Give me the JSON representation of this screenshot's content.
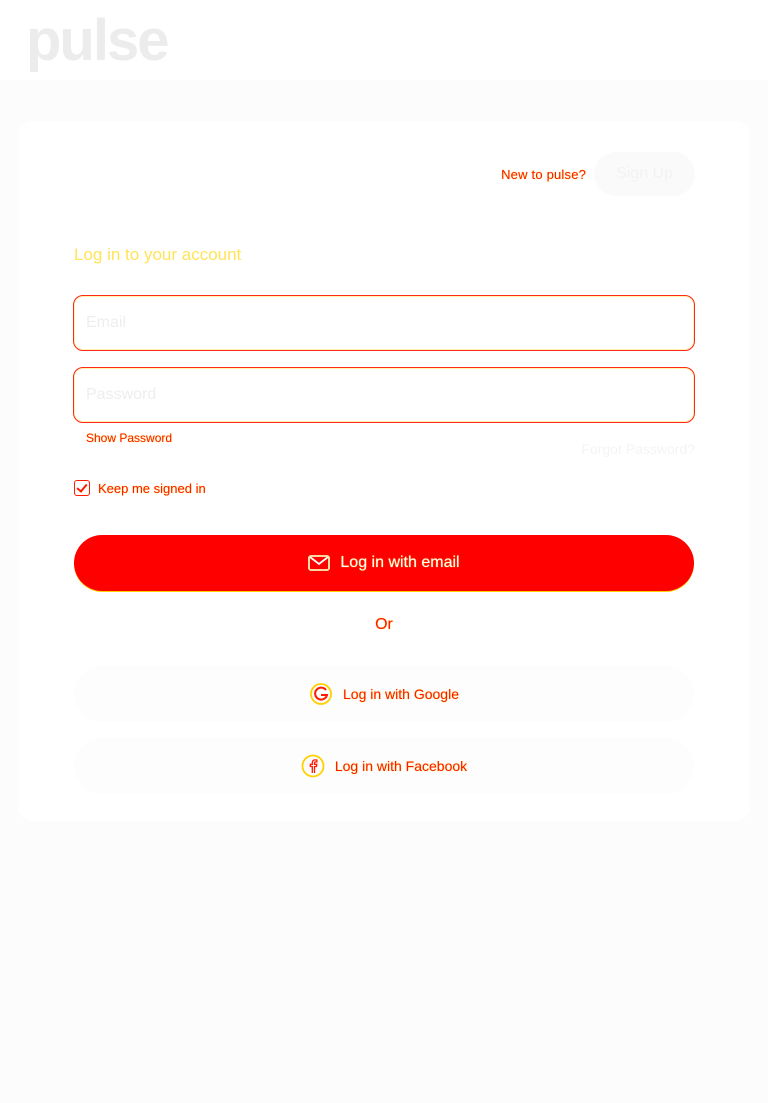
{
  "header": {
    "logo_text": "pulse"
  },
  "signup": {
    "prompt": "New to pulse?",
    "button_label": "Sign Up"
  },
  "login": {
    "heading": "Log in to your account",
    "email_placeholder": "Email",
    "password_placeholder": "Password",
    "show_password_label": "Show Password",
    "forgot_password_label": "Forgot Password?",
    "keep_signed_in_label": "Keep me signed in",
    "keep_signed_in_checked": true,
    "email_button_label": "Log in with email",
    "or_label": "Or",
    "google_button_label": "Log in with Google",
    "facebook_button_label": "Log in with Facebook"
  },
  "icons": {
    "email_button": "envelope-icon",
    "google_button": "google-icon",
    "facebook_button": "facebook-icon"
  },
  "colors": {
    "accent": "#ff0000",
    "outline_highlight": "#ffd000"
  }
}
